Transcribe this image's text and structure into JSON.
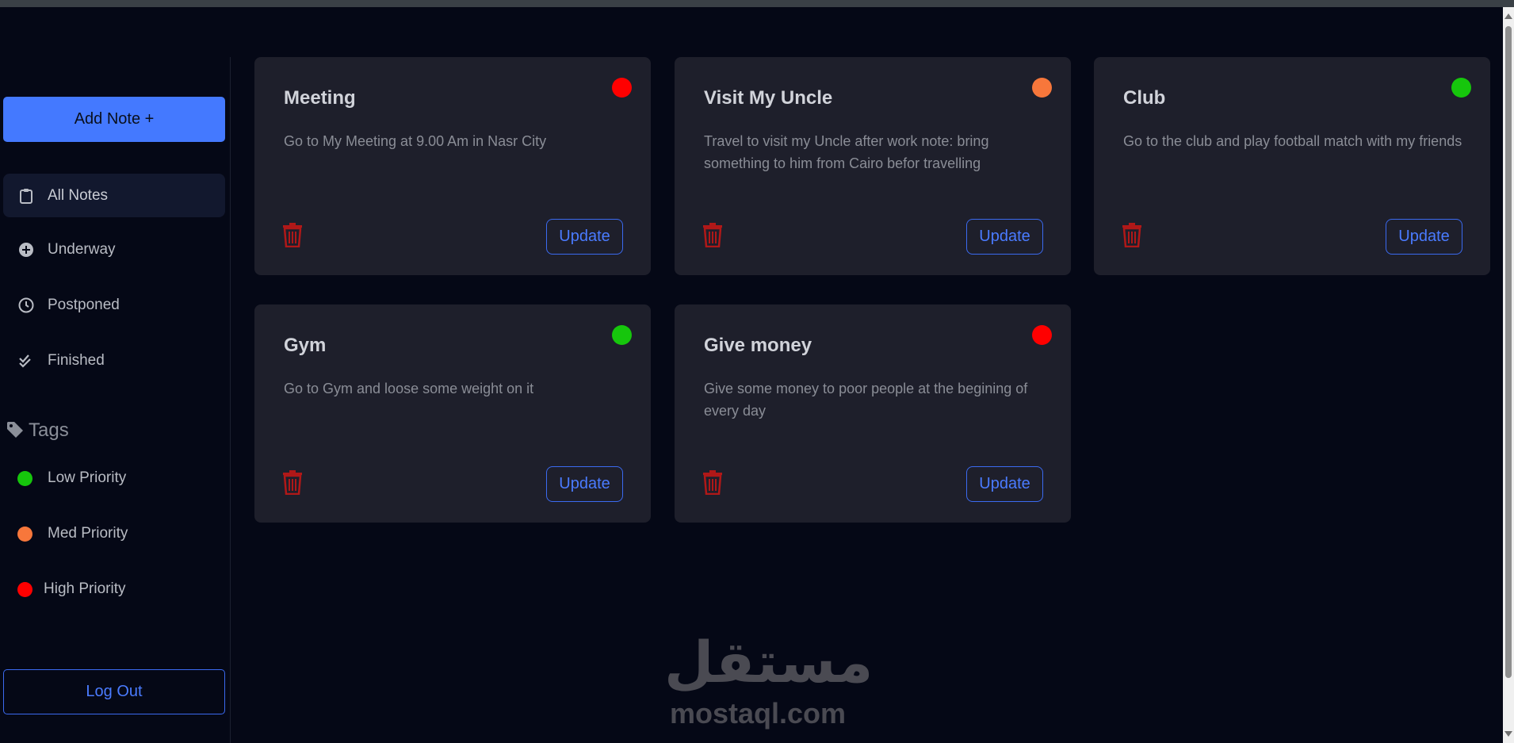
{
  "sidebar": {
    "add_button": "Add Note +",
    "nav": [
      {
        "label": "All Notes",
        "icon": "clipboard-icon",
        "active": true
      },
      {
        "label": "Underway",
        "icon": "plus-circle-icon",
        "active": false
      },
      {
        "label": "Postponed",
        "icon": "clock-icon",
        "active": false
      },
      {
        "label": "Finished",
        "icon": "double-check-icon",
        "active": false
      }
    ],
    "tags_heading": "Tags",
    "tags": [
      {
        "label": "Low Priority",
        "color": "#16c60c"
      },
      {
        "label": "Med Priority",
        "color": "#f7773b"
      },
      {
        "label": "High Priority",
        "color": "#ff0000"
      }
    ],
    "logout": "Log Out"
  },
  "notes": [
    {
      "title": "Meeting",
      "description": "Go to My Meeting at 9.00 Am in Nasr City",
      "priority_color": "#ff0000",
      "update_label": "Update"
    },
    {
      "title": "Visit My Uncle",
      "description": "Travel to visit my Uncle after work note: bring something to him from Cairo befor travelling",
      "priority_color": "#f7773b",
      "update_label": "Update"
    },
    {
      "title": "Club",
      "description": "Go to the club and play football match with my friends",
      "priority_color": "#16c60c",
      "update_label": "Update"
    },
    {
      "title": "Gym",
      "description": "Go to Gym and loose some weight on it",
      "priority_color": "#16c60c",
      "update_label": "Update"
    },
    {
      "title": "Give money",
      "description": "Give some money to poor people at the begining of every day",
      "priority_color": "#ff0000",
      "update_label": "Update"
    }
  ],
  "watermark": {
    "arabic": "مستقل",
    "latin": "mostaql.com"
  },
  "colors": {
    "accent": "#4479ff",
    "background": "#050816",
    "card": "#1e1f2b",
    "trash": "#b01818"
  }
}
